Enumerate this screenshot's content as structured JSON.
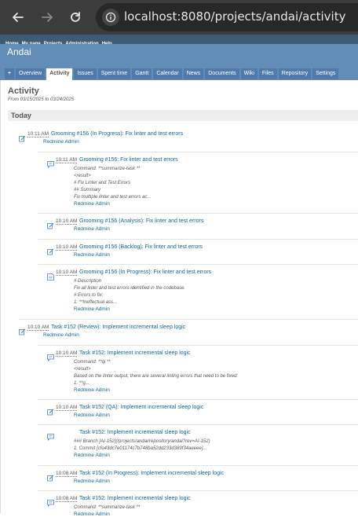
{
  "browser": {
    "url": "localhost:8080/projects/andai/activity"
  },
  "topmenu": [
    "Home",
    "My page",
    "Projects",
    "Administration",
    "Help"
  ],
  "project": {
    "title": "Andai"
  },
  "tabs": [
    {
      "label": "+"
    },
    {
      "label": "Overview"
    },
    {
      "label": "Activity",
      "selected": true
    },
    {
      "label": "Issues"
    },
    {
      "label": "Spent time"
    },
    {
      "label": "Gantt"
    },
    {
      "label": "Calendar"
    },
    {
      "label": "News"
    },
    {
      "label": "Documents"
    },
    {
      "label": "Wiki"
    },
    {
      "label": "Files"
    },
    {
      "label": "Repository"
    },
    {
      "label": "Settings"
    }
  ],
  "activity": {
    "heading": "Activity",
    "range": "From 03/15/2025 to 03/24/2025",
    "day": "Today",
    "entries": [
      {
        "icon": "edit",
        "time": "10:11 AM",
        "title": "Grooming #156 (In Progress): Fix linter and test errors",
        "author": "Redmine Admin",
        "desc": []
      },
      {
        "icon": "note",
        "time": "10:11 AM",
        "title": "Grooming #156: Fix linter and test errors",
        "author": "Redmine Admin",
        "desc": [
          "Command: **summarize-task **",
          "<result>",
          "# Fix Linter and Test Errors",
          "## Summary",
          "Fix multiple linter and test errors ac..."
        ]
      },
      {
        "icon": "edit",
        "time": "10:10 AM",
        "title": "Grooming #156 (Analysis): Fix linter and test errors",
        "author": "Redmine Admin",
        "desc": []
      },
      {
        "icon": "edit",
        "time": "10:10 AM",
        "title": "Grooming #156 (Backlog): Fix linter and test errors",
        "author": "Redmine Admin",
        "desc": []
      },
      {
        "icon": "new",
        "time": "10:10 AM",
        "title": "Grooming #156 (In Progress): Fix linter and test errors",
        "author": "Redmine Admin",
        "desc": [
          "# Description",
          "Fix all linter and test errors identified in the codebase.",
          "# Errors to fix:",
          "1. **Ineffectual ass..."
        ]
      },
      {
        "icon": "edit",
        "time": "10:10 AM",
        "title": "Task #152 (Review): Implement incremental sleep logic",
        "author": "Redmine Admin",
        "desc": []
      },
      {
        "icon": "note",
        "time": "10:10 AM",
        "title": "Task #152: Implement incremental sleep logic",
        "author": "Redmine Admin",
        "desc": [
          "Command: **qi **",
          "<result>",
          "Based on the linter output, there are several linting errors that need to be fixed:",
          "1. **g..."
        ]
      },
      {
        "icon": "edit",
        "time": "10:10 AM",
        "title": "Task #152 (QA): Implement incremental sleep logic",
        "author": "Redmine Admin",
        "desc": []
      },
      {
        "icon": "note",
        "time": "",
        "title": "Task #152: Implement incremental sleep logic",
        "author": "Redmine Admin",
        "desc": [
          "### Branch [AI-152](/projects/andai/repository/andai?rev=AI-152)",
          "1. Commit [cfo43dc7e01174c7b748ba52dd233d389f34aeeee]..."
        ]
      },
      {
        "icon": "edit",
        "time": "10:08 AM",
        "title": "Task #152 (In Progress): Implement incremental sleep logic",
        "author": "Redmine Admin",
        "desc": []
      },
      {
        "icon": "note",
        "time": "10:08 AM",
        "title": "Task #152: Implement incremental sleep logic",
        "author": "Redmine Admin",
        "desc": [
          "Command: **summarize-task **"
        ]
      }
    ]
  }
}
